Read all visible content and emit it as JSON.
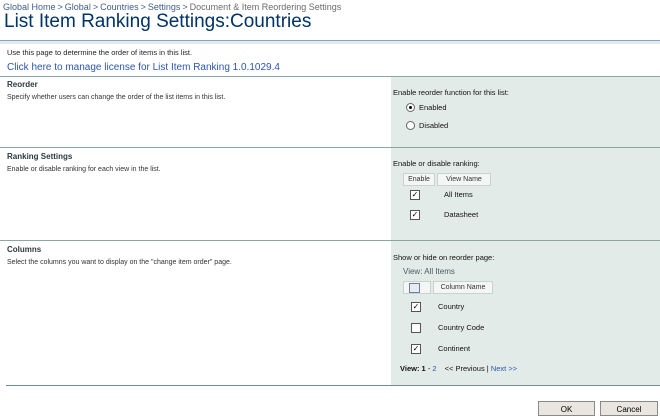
{
  "breadcrumb": {
    "items": [
      "Global Home",
      "Global",
      "Countries",
      "Settings"
    ],
    "current": "Document & Item Reordering Settings",
    "separator": ">"
  },
  "title": {
    "main": "List Item Ranking Settings:",
    "sub": "Countries"
  },
  "intro": "Use this page to determine the order of items in this list.",
  "license_link": "Click here to manage license for List Item Ranking 1.0.1029.4",
  "reorder": {
    "title": "Reorder",
    "description": "Specify whether users can change the order of the list items in this list.",
    "label": "Enable reorder function for this list:",
    "options": [
      {
        "label": "Enabled",
        "selected": true
      },
      {
        "label": "Disabled",
        "selected": false
      }
    ]
  },
  "ranking": {
    "title": "Ranking Settings",
    "description": "Enable or disable ranking for each view in the list.",
    "label": "Enable or disable ranking:",
    "headers": {
      "enable": "Enable",
      "view_name": "View Name"
    },
    "rows": [
      {
        "name": "All Items",
        "checked": true
      },
      {
        "name": "Datasheet",
        "checked": true
      }
    ]
  },
  "columns": {
    "title": "Columns",
    "description": "Select the columns you want to display on the \"change item order\" page.",
    "label": "Show or hide on reorder page:",
    "view_label": "View: All Items",
    "header": "Column Name",
    "rows": [
      {
        "name": "Country",
        "checked": true
      },
      {
        "name": "Country Code",
        "checked": false
      },
      {
        "name": "Continent",
        "checked": true
      }
    ],
    "pager": {
      "view_label": "View:",
      "page_1": "1",
      "dash": "-",
      "page_2": "2",
      "previous": "<< Previous",
      "divider": "|",
      "next": "Next >>"
    }
  },
  "buttons": {
    "ok": "OK",
    "cancel": "Cancel"
  },
  "colors": {
    "title": "#003366",
    "link": "#2a56b0",
    "panel": "#e3ebe8"
  }
}
